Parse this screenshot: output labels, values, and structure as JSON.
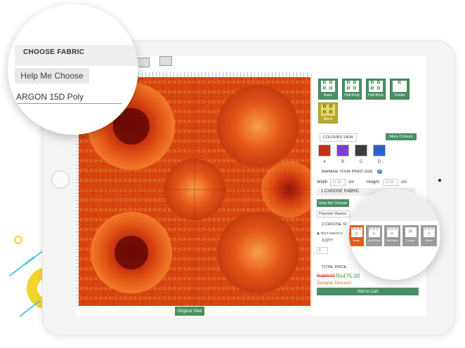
{
  "preview": {
    "original_view_label": "Original View"
  },
  "repeat_options": [
    {
      "label": "Basic",
      "icon": "R R R R"
    },
    {
      "label": "Half-Drop",
      "icon": "R R R R"
    },
    {
      "label": "Half-Brick",
      "icon": "R R R R"
    },
    {
      "label": "Center",
      "icon": "R"
    },
    {
      "label": "Mirror",
      "icon": "R R R R"
    }
  ],
  "colours": {
    "title": "COLOURS VIEW",
    "more_label": "More Colours",
    "swatches": [
      {
        "label": "A",
        "color": "#c92b1c"
      },
      {
        "label": "B",
        "color": "#7a3fd0"
      },
      {
        "label": "C",
        "color": "#3c3c3c"
      },
      {
        "label": "D",
        "color": "#2a62c9"
      }
    ]
  },
  "print_size": {
    "title": "MANAGE YOUR PRINT SIZE",
    "width_label": "Width:",
    "width_value": "13.33",
    "height_label": "Height:",
    "height_value": "10.00",
    "unit": "cm"
  },
  "steps": {
    "choose_fabric": "1.CHOOSE FABRIC",
    "help_label": "Help Me Choose",
    "fabric_value": "Polyester Washer",
    "choose_size": "2.CHOOSE SI",
    "test_swatch": "TEST SWATCH",
    "qty_label": "3.QTY",
    "qty_value": "1"
  },
  "pricing": {
    "total_label": "TOTAL PRICE:",
    "old_price": "Rs500.00",
    "new_price": "Rs475.00",
    "discount_label": "Designer Discount",
    "add_to_cart": "Add to Cart"
  },
  "zoom_fabric": {
    "title": "CHOOSE FABRIC",
    "help_label": "Help Me Choose",
    "fabric_value": "ARGON 15D Poly"
  },
  "zoom_repeat": [
    {
      "label": "Basic",
      "icon": "R R R R"
    },
    {
      "label": "Half-Drop",
      "icon": "R R R R"
    },
    {
      "label": "Half-Brick",
      "icon": "R R R R"
    },
    {
      "label": "Center",
      "icon": "R"
    },
    {
      "label": "Mirror",
      "icon": "R R R R"
    }
  ],
  "colors": {
    "accent_green": "#4a8f63",
    "mirror_olive": "#b4ac2c",
    "selected_orange": "#e05b1c",
    "deco_yellow": "#f1d52c",
    "deco_cyan": "#52c6dd",
    "old_price_red": "#c43b2a",
    "new_price_green": "#3f9b3f"
  }
}
